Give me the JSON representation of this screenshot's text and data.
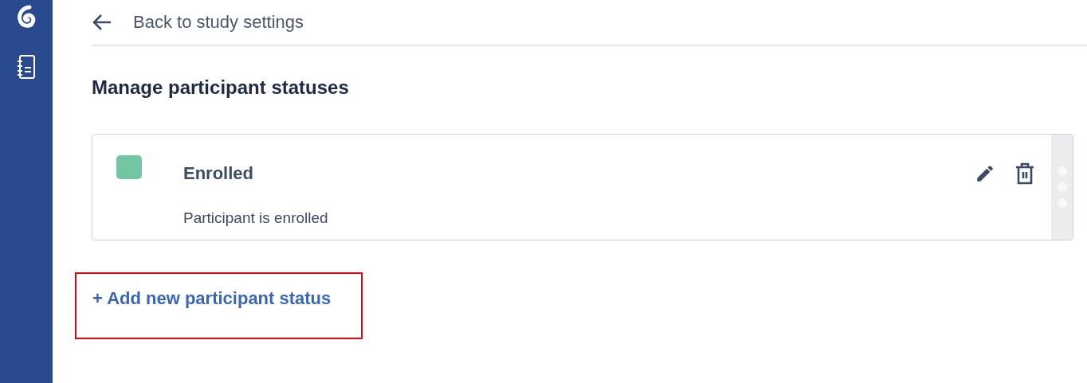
{
  "back_link": {
    "label": "Back to study settings"
  },
  "heading": "Manage participant statuses",
  "statuses": [
    {
      "name": "Enrolled",
      "description": "Participant is enrolled",
      "color": "#72c6a2"
    }
  ],
  "add_link": {
    "label": "+ Add new participant status"
  }
}
